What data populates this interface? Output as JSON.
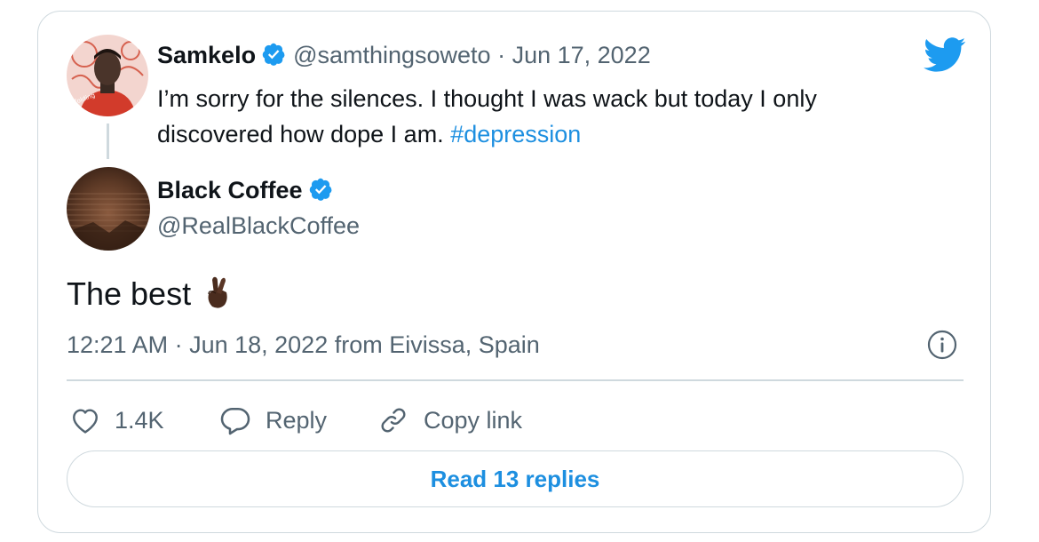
{
  "quoted_tweet": {
    "author_name": "Samkelo",
    "author_handle": "@samthingsoweto",
    "separator": " · ",
    "date": "Jun 17, 2022",
    "text_before_hashtag": "I’m sorry for the silences. I thought I was wack but today I only discovered how dope I am. ",
    "hashtag": "#depression"
  },
  "tweet": {
    "author_name": "Black Coffee",
    "author_handle": "@RealBlackCoffee",
    "text": "The best",
    "timestamp": "12:21 AM · Jun 18, 2022 from Eivissa, Spain"
  },
  "actions": {
    "like_count": "1.4K",
    "reply_label": "Reply",
    "copy_link_label": "Copy link"
  },
  "read_replies_label": "Read 13 replies",
  "colors": {
    "accent": "#1d9bf0",
    "link": "#1d8fe0",
    "muted_text": "#536471",
    "border": "#cfd9de"
  },
  "icons": [
    "twitter-bird-icon",
    "verified-badge-icon",
    "crossed-fingers-emoji",
    "info-icon",
    "heart-icon",
    "reply-bubble-icon",
    "link-icon"
  ]
}
